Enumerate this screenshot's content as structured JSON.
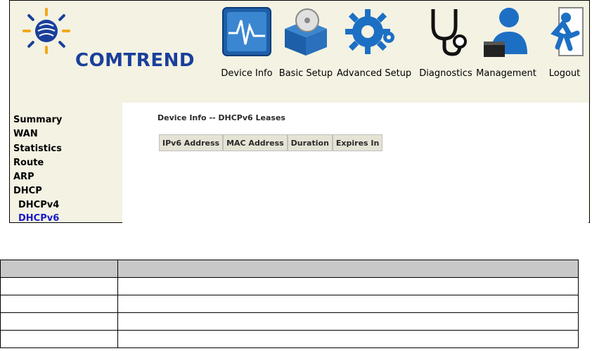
{
  "brand": {
    "name": "COMTREND"
  },
  "nav": [
    {
      "label": "Device Info",
      "icon": "device-info-icon"
    },
    {
      "label": "Basic Setup",
      "icon": "basic-setup-icon"
    },
    {
      "label": "Advanced Setup",
      "icon": "gear-icon"
    },
    {
      "label": "Diagnostics",
      "icon": "stethoscope-icon"
    },
    {
      "label": "Management",
      "icon": "user-icon"
    },
    {
      "label": "Logout",
      "icon": "logout-icon"
    }
  ],
  "sidebar": {
    "items": [
      {
        "label": "Summary"
      },
      {
        "label": "WAN"
      },
      {
        "label": "Statistics"
      },
      {
        "label": "Route"
      },
      {
        "label": "ARP"
      },
      {
        "label": "DHCP"
      },
      {
        "label": "DHCPv4"
      },
      {
        "label": "DHCPv6"
      }
    ]
  },
  "main": {
    "title": "Device Info -- DHCPv6 Leases",
    "columns": [
      "IPv6 Address",
      "MAC Address",
      "Duration",
      "Expires In"
    ]
  },
  "colors": {
    "brand": "#1a3f9b",
    "active_link": "#1a1acc",
    "header_bg": "#f3f2e3"
  }
}
